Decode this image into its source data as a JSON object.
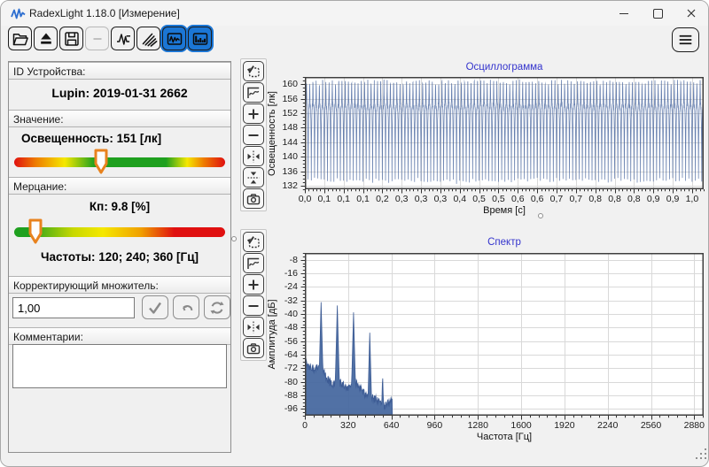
{
  "window": {
    "title": "RadexLight 1.18.0 [Измерение]"
  },
  "toolbar": {
    "buttons": [
      {
        "name": "open",
        "active": false,
        "disabled": false
      },
      {
        "name": "eject",
        "active": false,
        "disabled": false
      },
      {
        "name": "save",
        "active": false,
        "disabled": false
      },
      {
        "name": "dash-disabled",
        "active": false,
        "disabled": true
      },
      {
        "name": "pulse-measure",
        "active": false,
        "disabled": false
      },
      {
        "name": "rays",
        "active": false,
        "disabled": false
      },
      {
        "name": "oscillogram-view",
        "active": true,
        "disabled": false
      },
      {
        "name": "spectrum-view",
        "active": true,
        "disabled": false
      }
    ]
  },
  "sidebar": {
    "device_id": {
      "label": "ID Устройства:",
      "value": "Lupin: 2019-01-31 2662"
    },
    "value_section": {
      "label": "Значение:",
      "reading": "Освещенность: 151 [лк]",
      "slider_pos_pct": 41
    },
    "flicker_section": {
      "label": "Мерцание:",
      "kp": "Кп: 9.8 [%]",
      "frequencies": "Частоты: 120; 240; 360 [Гц]",
      "slider_pos_pct": 10
    },
    "multiplier_section": {
      "label": "Корректирующий множитель:",
      "value": "1,00"
    },
    "comments_section": {
      "label": "Комментарии:",
      "value": ""
    }
  },
  "chart_tools_oscillogram": [
    "zoom-select",
    "fit-frame",
    "zoom-in",
    "zoom-out",
    "fit-horizontal",
    "fit-vertical",
    "snapshot"
  ],
  "chart_tools_spectrum": [
    "zoom-select",
    "fit-frame",
    "zoom-in",
    "zoom-out",
    "fit-horizontal",
    "snapshot"
  ],
  "colors": {
    "accent_blue": "#1b76d5",
    "chart_title": "#3434cd",
    "waveform": "#4a679b",
    "spectrum_fill": "#4a6ca3",
    "slider_marker": "#e8821e",
    "slider_green": "#1fa01f",
    "slider_yellow": "#f5e800",
    "slider_red": "#e01010"
  },
  "chart_data": [
    {
      "type": "line",
      "title": "Осциллограмма",
      "xlabel": "Время [с]",
      "ylabel": "Освещенность [лк]",
      "xlim": [
        0,
        1.03
      ],
      "ylim": [
        131,
        162
      ],
      "grid": true,
      "x_ticks": [
        {
          "pos": 0.0,
          "label": "0,0"
        },
        {
          "pos": 0.05,
          "label": "0,1"
        },
        {
          "pos": 0.1,
          "label": "0,1"
        },
        {
          "pos": 0.15,
          "label": "0,1"
        },
        {
          "pos": 0.2,
          "label": "0,2"
        },
        {
          "pos": 0.25,
          "label": "0,3"
        },
        {
          "pos": 0.3,
          "label": "0,3"
        },
        {
          "pos": 0.35,
          "label": "0,3"
        },
        {
          "pos": 0.4,
          "label": "0,4"
        },
        {
          "pos": 0.45,
          "label": "0,5"
        },
        {
          "pos": 0.5,
          "label": "0,5"
        },
        {
          "pos": 0.55,
          "label": "0,6"
        },
        {
          "pos": 0.6,
          "label": "0,6"
        },
        {
          "pos": 0.65,
          "label": "0,7"
        },
        {
          "pos": 0.7,
          "label": "0,7"
        },
        {
          "pos": 0.75,
          "label": "0,8"
        },
        {
          "pos": 0.8,
          "label": "0,8"
        },
        {
          "pos": 0.85,
          "label": "0,8"
        },
        {
          "pos": 0.9,
          "label": "0,9"
        },
        {
          "pos": 0.95,
          "label": "0,9"
        },
        {
          "pos": 1.0,
          "label": "1,0"
        }
      ],
      "y_ticks": [
        160,
        156,
        152,
        148,
        144,
        140,
        136,
        132
      ],
      "signal": {
        "description": "120 Hz light-flicker waveform, ~120 periods over 1 s, dips to 133 lx, dense band 152-156 lx, peaks to 160 lx",
        "frequency_hz": 120,
        "min_lx": 133,
        "plateau_lx": 154,
        "peak_lx": 160.5,
        "mean_lx": 151
      }
    },
    {
      "type": "area",
      "title": "Спектр",
      "xlabel": "Частота [Гц]",
      "ylabel": "Амплитуда [дБ]",
      "xlim": [
        0,
        2950
      ],
      "ylim": [
        -100,
        -4
      ],
      "grid": true,
      "x_ticks": [
        {
          "pos": 0,
          "label": "0"
        },
        {
          "pos": 320,
          "label": "320"
        },
        {
          "pos": 640,
          "label": "640"
        },
        {
          "pos": 960,
          "label": "960"
        },
        {
          "pos": 1280,
          "label": "1280"
        },
        {
          "pos": 1600,
          "label": "1600"
        },
        {
          "pos": 1920,
          "label": "1920"
        },
        {
          "pos": 2240,
          "label": "2240"
        },
        {
          "pos": 2560,
          "label": "2560"
        },
        {
          "pos": 2880,
          "label": "2880"
        }
      ],
      "y_ticks": [
        -8,
        -16,
        -24,
        -32,
        -40,
        -48,
        -56,
        -64,
        -72,
        -80,
        -88,
        -96
      ],
      "peaks": [
        {
          "freq_hz": 5,
          "db": -71
        },
        {
          "freq_hz": 120,
          "db": -33
        },
        {
          "freq_hz": 240,
          "db": -35
        },
        {
          "freq_hz": 360,
          "db": -39
        },
        {
          "freq_hz": 480,
          "db": -51
        },
        {
          "freq_hz": 575,
          "db": -75
        }
      ],
      "noise_floor": {
        "start_db": -73.5,
        "end_db": -96.5,
        "cutoff_hz": 645
      }
    }
  ]
}
